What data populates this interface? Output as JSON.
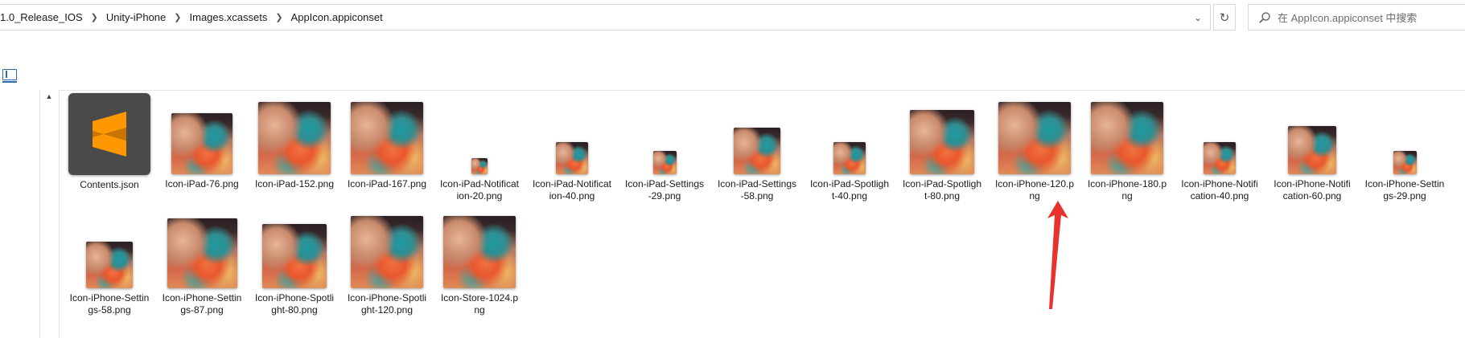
{
  "breadcrumbs": [
    "1.0_Release_IOS",
    "Unity-iPhone",
    "Images.xcassets",
    "AppIcon.appiconset"
  ],
  "search": {
    "placeholder": "在 AppIcon.appiconset 中搜索"
  },
  "icons": {
    "dropdown": "chevron-down-icon",
    "refresh": "refresh-icon",
    "search": "search-icon",
    "view": "preview-pane-icon",
    "scroll_up": "scroll-up-icon",
    "json_file": "sublime-text-icon",
    "image_file": "image-thumbnail-icon"
  },
  "colors": {
    "accent": "#2b6cb0",
    "annotation_arrow": "#e8322d",
    "sublime_orange": "#ff9800",
    "json_tile_bg": "#4a4a4a"
  },
  "files": [
    {
      "name": "Contents.json",
      "kind": "json"
    },
    {
      "name": "Icon-iPad-76.png",
      "kind": "image"
    },
    {
      "name": "Icon-iPad-152.png",
      "kind": "image"
    },
    {
      "name": "Icon-iPad-167.png",
      "kind": "image"
    },
    {
      "name": "Icon-iPad-Notification-20.png",
      "kind": "image"
    },
    {
      "name": "Icon-iPad-Notification-40.png",
      "kind": "image"
    },
    {
      "name": "Icon-iPad-Settings-29.png",
      "kind": "image"
    },
    {
      "name": "Icon-iPad-Settings-58.png",
      "kind": "image"
    },
    {
      "name": "Icon-iPad-Spotlight-40.png",
      "kind": "image"
    },
    {
      "name": "Icon-iPad-Spotlight-80.png",
      "kind": "image"
    },
    {
      "name": "Icon-iPhone-120.png",
      "kind": "image"
    },
    {
      "name": "Icon-iPhone-180.png",
      "kind": "image"
    },
    {
      "name": "Icon-iPhone-Notification-40.png",
      "kind": "image"
    },
    {
      "name": "Icon-iPhone-Notification-60.png",
      "kind": "image"
    },
    {
      "name": "Icon-iPhone-Settings-29.png",
      "kind": "image"
    },
    {
      "name": "Icon-iPhone-Settings-58.png",
      "kind": "image"
    },
    {
      "name": "Icon-iPhone-Settings-87.png",
      "kind": "image"
    },
    {
      "name": "Icon-iPhone-Spotlight-80.png",
      "kind": "image"
    },
    {
      "name": "Icon-iPhone-Spotlight-120.png",
      "kind": "image"
    },
    {
      "name": "Icon-Store-1024.png",
      "kind": "image"
    }
  ]
}
